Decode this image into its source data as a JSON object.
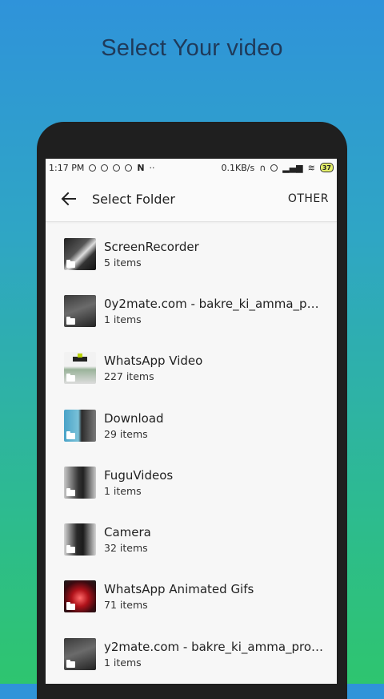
{
  "headline": "Select Your video",
  "status_bar": {
    "time": "1:17 PM",
    "net_speed": "0.1KB/s",
    "battery": "37"
  },
  "toolbar": {
    "title": "Select Folder",
    "other_label": "OTHER"
  },
  "folders": [
    {
      "name": "ScreenRecorder",
      "count": "5 items"
    },
    {
      "name": "0y2mate.com - bakre_ki_amma_p…",
      "count": "1 items"
    },
    {
      "name": "WhatsApp Video",
      "count": "227 items"
    },
    {
      "name": "Download",
      "count": "29 items"
    },
    {
      "name": "FuguVideos",
      "count": "1 items"
    },
    {
      "name": "Camera",
      "count": "32 items"
    },
    {
      "name": "WhatsApp Animated Gifs",
      "count": "71 items"
    },
    {
      "name": "y2mate.com - bakre_ki_amma_pro…",
      "count": "1 items"
    }
  ]
}
